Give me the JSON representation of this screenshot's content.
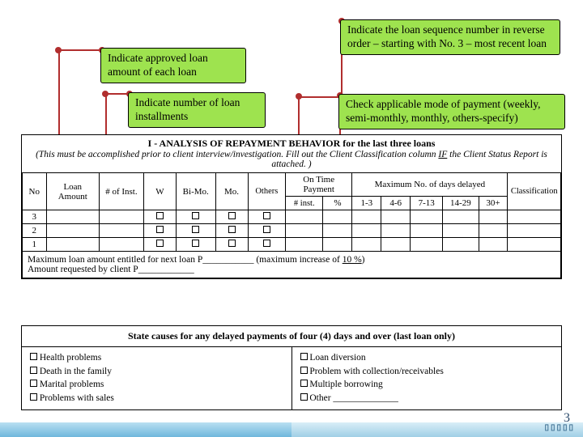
{
  "callouts": {
    "c1": "Indicate approved loan amount of each loan",
    "c2": "Indicate the loan sequence number in reverse order – starting with No. 3 – most recent loan",
    "c3": "Indicate number of loan installments",
    "c4": "Check applicable mode of payment (weekly, semi-monthly, monthly, others-specify)"
  },
  "section": {
    "title": "I - ANALYSIS OF REPAYMENT BEHAVIOR for the last three loans",
    "sub_pre": "(This must be accomplished prior to client interview/investigation. Fill out the Client Classification column ",
    "sub_if": "IF",
    "sub_post": " the Client Status Report is attached. )"
  },
  "headers": {
    "no": "No",
    "loan_amount": "Loan Amount",
    "of_inst": "# of Inst.",
    "w": "W",
    "bimo": "Bi-Mo.",
    "mo": "Mo.",
    "others": "Others",
    "on_time": "On Time Payment",
    "max_delay": "Maximum No. of days delayed",
    "classification": "Classification",
    "n_inst": "# inst.",
    "pct": "%",
    "r1": "1-3",
    "r2": "4-6",
    "r3": "7-13",
    "r4": "14-29",
    "r5": "30+"
  },
  "rows": {
    "r1": "3",
    "r2": "2",
    "r3": "1"
  },
  "footer": {
    "l1a": "Maximum loan amount entitled for next loan   P___________ (maximum increase of ",
    "l1b": "10 %",
    "l1c": ")",
    "l2": "Amount requested by client                                 P____________"
  },
  "causes": {
    "title": "State causes for any delayed payments of four (4) days and over (last loan only)",
    "left": [
      "Health problems",
      "Death in the family",
      "Marital problems",
      "Problems with sales"
    ],
    "right": [
      "Loan diversion",
      "Problem with collection/receivables",
      "Multiple borrowing",
      "Other ______________"
    ]
  },
  "pagenum": "3"
}
